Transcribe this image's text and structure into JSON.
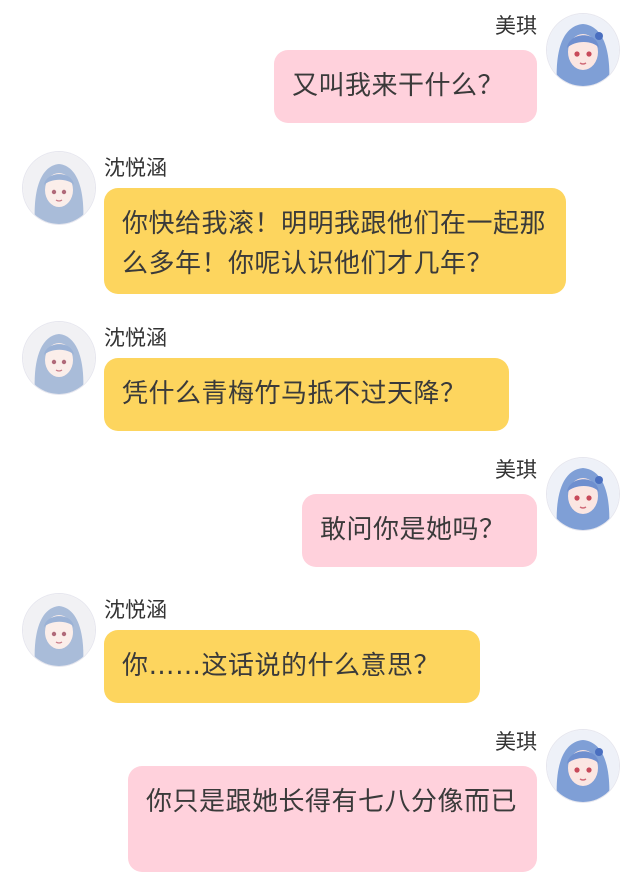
{
  "users": {
    "right": {
      "name": "美琪",
      "avatar_icon": "anime-girl-avatar-meiqi-icon"
    },
    "left": {
      "name": "沈悦涵",
      "avatar_icon": "anime-girl-avatar-shenyuehan-icon"
    }
  },
  "colors": {
    "right_bubble": "#ffd1dc",
    "left_bubble": "#fdd55e",
    "background": "#ffffff"
  },
  "messages": [
    {
      "side": "right",
      "name": "美琪",
      "text": "又叫我来干什么？"
    },
    {
      "side": "left",
      "name": "沈悦涵",
      "text": "你快给我滚！明明我跟他们在一起那么多年！你呢认识他们才几年？"
    },
    {
      "side": "left",
      "name": "沈悦涵",
      "text": "凭什么青梅竹马抵不过天降？"
    },
    {
      "side": "right",
      "name": "美琪",
      "text": "敢问你是她吗？"
    },
    {
      "side": "left",
      "name": "沈悦涵",
      "text": "你……这话说的什么意思？"
    },
    {
      "side": "right",
      "name": "美琪",
      "text": "你只是跟她长得有七八分像而已"
    }
  ]
}
